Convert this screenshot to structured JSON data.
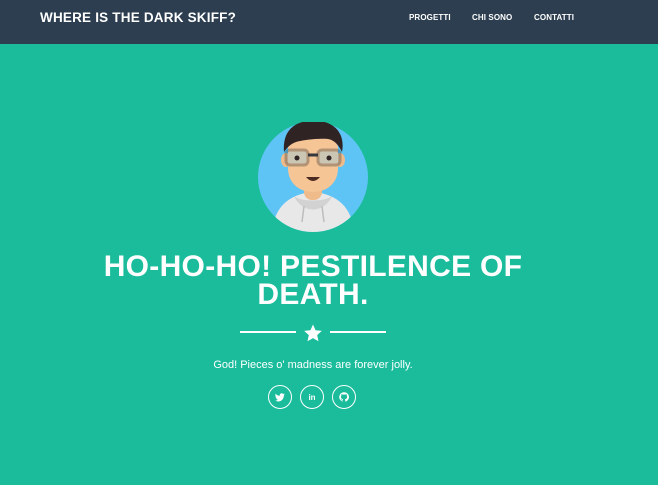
{
  "navbar": {
    "brand": "WHERE IS THE DARK SKIFF?",
    "items": [
      {
        "label": "PROGETTI"
      },
      {
        "label": "CHI SONO"
      },
      {
        "label": "CONTATTI"
      }
    ]
  },
  "hero": {
    "title": "HO-HO-HO! PESTILENCE OF DEATH.",
    "tagline": "God! Pieces o' madness are forever jolly.",
    "social": [
      {
        "icon": "twitter-icon"
      },
      {
        "icon": "linkedin-icon",
        "label": "in"
      },
      {
        "icon": "github-icon"
      }
    ]
  },
  "colors": {
    "navbar_bg": "#2c3e50",
    "hero_bg": "#1abc9c",
    "text": "#ffffff"
  }
}
